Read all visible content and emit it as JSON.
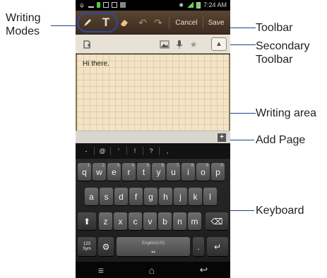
{
  "annotations": {
    "writing_modes": "Writing\nModes",
    "toolbar": "Toolbar",
    "secondary_toolbar": "Secondary\nToolbar",
    "writing_area": "Writing area",
    "add_page": "Add Page",
    "keyboard": "Keyboard"
  },
  "status_bar": {
    "time": "7:24 AM"
  },
  "toolbar": {
    "text_mode_label": "T",
    "cancel_label": "Cancel",
    "save_label": "Save"
  },
  "writing_area": {
    "content": "Hi there."
  },
  "keyboard": {
    "symbol_row": [
      "-",
      "@",
      "'",
      "!",
      "?",
      ","
    ],
    "row1": [
      {
        "key": "q",
        "alt": "1"
      },
      {
        "key": "w",
        "alt": "2"
      },
      {
        "key": "e",
        "alt": "3"
      },
      {
        "key": "r",
        "alt": "4"
      },
      {
        "key": "t",
        "alt": "5"
      },
      {
        "key": "y",
        "alt": "6"
      },
      {
        "key": "u",
        "alt": "7"
      },
      {
        "key": "i",
        "alt": "8"
      },
      {
        "key": "o",
        "alt": "9"
      },
      {
        "key": "p",
        "alt": "0"
      }
    ],
    "row2": [
      "a",
      "s",
      "d",
      "f",
      "g",
      "h",
      "j",
      "k",
      "l"
    ],
    "row3": [
      "z",
      "x",
      "c",
      "v",
      "b",
      "n",
      "m"
    ],
    "sym_key": "123\nSym",
    "space_label": "English(US)"
  },
  "colors": {
    "annotation_line": "#1e3f8f",
    "toolbar_bg": "#4a3828",
    "writing_bg": "#f2e4c4"
  }
}
